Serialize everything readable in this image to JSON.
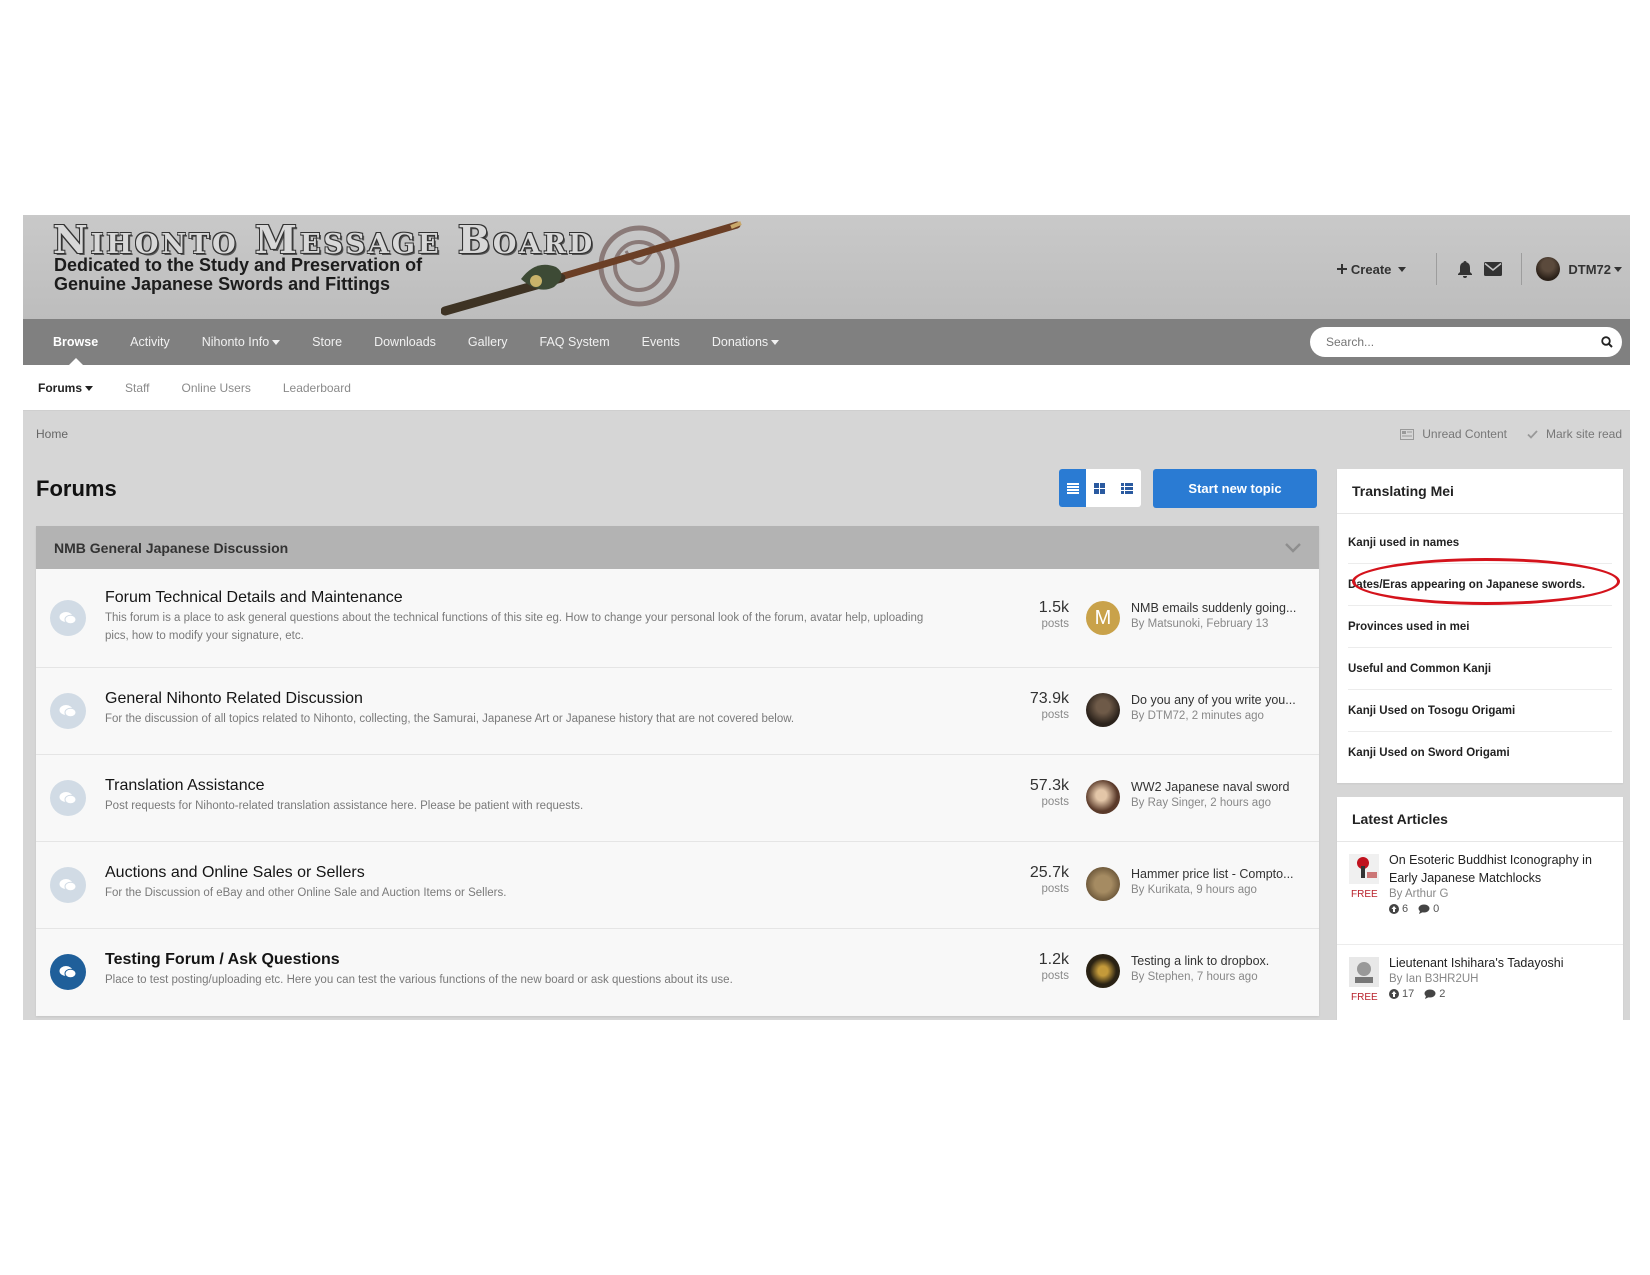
{
  "header": {
    "logo_title": "Nihonto Message Board",
    "logo_subtitle": "Dedicated to the Study and Preservation of Genuine Japanese Swords and Fittings",
    "create_label": "Create",
    "username": "DTM72"
  },
  "nav": {
    "items": [
      {
        "label": "Browse"
      },
      {
        "label": "Activity"
      },
      {
        "label": "Nihonto Info"
      },
      {
        "label": "Store"
      },
      {
        "label": "Downloads"
      },
      {
        "label": "Gallery"
      },
      {
        "label": "FAQ System"
      },
      {
        "label": "Events"
      },
      {
        "label": "Donations"
      }
    ],
    "search_placeholder": "Search..."
  },
  "subnav": {
    "items": [
      {
        "label": "Forums"
      },
      {
        "label": "Staff"
      },
      {
        "label": "Online Users"
      },
      {
        "label": "Leaderboard"
      }
    ]
  },
  "breadcrumb": {
    "home": "Home",
    "unread": "Unread Content",
    "mark_read": "Mark site read"
  },
  "main": {
    "title": "Forums",
    "start_topic": "Start new topic",
    "category": "NMB General Japanese Discussion",
    "forums": [
      {
        "name": "Forum Technical Details and Maintenance",
        "desc": "This forum is a place to ask general questions about the technical functions of this site eg. How to change your personal look of the forum, avatar help, uploading pics, how to modify your signature, etc.",
        "count": "1.5k",
        "count_label": "posts",
        "last_title": "NMB emails suddenly going...",
        "last_meta": "By Matsunoki, February 13"
      },
      {
        "name": "General Nihonto Related Discussion",
        "desc": "For the discussion of all topics related to Nihonto, collecting, the Samurai, Japanese Art or Japanese history that are not covered below.",
        "count": "73.9k",
        "count_label": "posts",
        "last_title": "Do you any of you write you...",
        "last_meta": "By DTM72, 2 minutes ago"
      },
      {
        "name": "Translation Assistance",
        "desc": "Post requests for Nihonto-related translation assistance here. Please be patient with requests.",
        "count": "57.3k",
        "count_label": "posts",
        "last_title": "WW2 Japanese naval sword",
        "last_meta": "By Ray Singer, 2 hours ago"
      },
      {
        "name": "Auctions and Online Sales or Sellers",
        "desc": "For the Discussion of eBay and other Online Sale and Auction Items or Sellers.",
        "count": "25.7k",
        "count_label": "posts",
        "last_title": "Hammer price list - Compto...",
        "last_meta": "By Kurikata, 9 hours ago"
      },
      {
        "name": "Testing Forum / Ask Questions",
        "desc": "Place to test posting/uploading etc. Here you can test the various functions of the new board or ask questions about its use.",
        "count": "1.2k",
        "count_label": "posts",
        "last_title": "Testing a link to dropbox.",
        "last_meta": "By Stephen, 7 hours ago"
      }
    ],
    "avatar_letter": "M"
  },
  "sidebar": {
    "translating": {
      "title": "Translating Mei",
      "items": [
        {
          "label": "Kanji used in names"
        },
        {
          "label": "Dates/Eras appearing on Japanese swords."
        },
        {
          "label": "Provinces used in mei"
        },
        {
          "label": "Useful and Common Kanji"
        },
        {
          "label": "Kanji Used on Tosogu Origami"
        },
        {
          "label": "Kanji Used on Sword Origami"
        }
      ]
    },
    "articles": {
      "title": "Latest Articles",
      "items": [
        {
          "title": "On Esoteric Buddhist Iconography in Early Japanese Matchlocks",
          "by": "By Arthur G",
          "badge": "FREE",
          "likes": "6",
          "comments": "0"
        },
        {
          "title": "Lieutenant Ishihara's Tadayoshi",
          "by": "By Ian B3HR2UH",
          "badge": "FREE",
          "likes": "17",
          "comments": "2"
        }
      ]
    }
  },
  "colors": {
    "accent": "#2a7bd3",
    "nav_bg": "#808080",
    "header_bg": "#c4c4c4",
    "unread_icon": "#1f5f9a",
    "highlight_oval": "#d4131c"
  }
}
